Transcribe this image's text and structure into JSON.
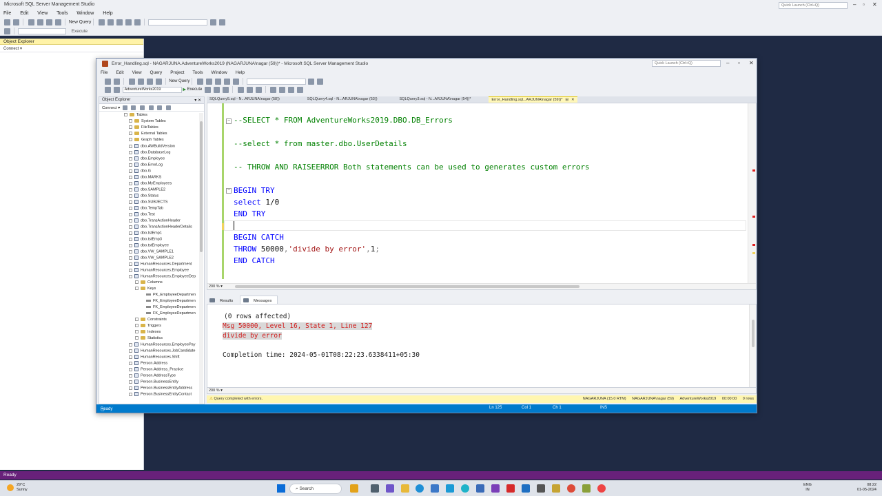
{
  "background_window": {
    "title": "Microsoft SQL Server Management Studio",
    "menu": [
      "File",
      "Edit",
      "View",
      "Tools",
      "Window",
      "Help"
    ],
    "new_query": "New Query",
    "execute": "Execute",
    "quick_launch": "Quick Launch (Ctrl+Q)",
    "object_explorer": "Object Explorer",
    "connect": "Connect",
    "ready": "Ready"
  },
  "main_window": {
    "title": "Error_Handling.sql - NAGARJUNA.AdventureWorks2019 (NAGARJUNA\\nagar (59))* - Microsoft SQL Server Management Studio",
    "quick_launch": "Quick Launch (Ctrl+Q)",
    "menu": [
      "File",
      "Edit",
      "View",
      "Query",
      "Project",
      "Tools",
      "Window",
      "Help"
    ],
    "new_query": "New Query",
    "database": "AdventureWorks2019",
    "execute": "Execute"
  },
  "object_explorer": {
    "title": "Object Explorer",
    "connect": "Connect",
    "nodes": [
      {
        "label": "Tables",
        "indent": 0,
        "icon": "folder",
        "expanded": true
      },
      {
        "label": "System Tables",
        "indent": 1,
        "icon": "folder"
      },
      {
        "label": "FileTables",
        "indent": 1,
        "icon": "folder"
      },
      {
        "label": "External Tables",
        "indent": 1,
        "icon": "folder"
      },
      {
        "label": "Graph Tables",
        "indent": 1,
        "icon": "folder"
      },
      {
        "label": "dbo.AWBuildVersion",
        "indent": 1,
        "icon": "table"
      },
      {
        "label": "dbo.DatabaseLog",
        "indent": 1,
        "icon": "table"
      },
      {
        "label": "dbo.Employee",
        "indent": 1,
        "icon": "table"
      },
      {
        "label": "dbo.ErrorLog",
        "indent": 1,
        "icon": "table"
      },
      {
        "label": "dbo.G",
        "indent": 1,
        "icon": "table"
      },
      {
        "label": "dbo.MARKS",
        "indent": 1,
        "icon": "table"
      },
      {
        "label": "dbo.MyEmployees",
        "indent": 1,
        "icon": "table"
      },
      {
        "label": "dbo.SAMPLE2",
        "indent": 1,
        "icon": "table"
      },
      {
        "label": "dbo.Status",
        "indent": 1,
        "icon": "table"
      },
      {
        "label": "dbo.SUBJECTS",
        "indent": 1,
        "icon": "table"
      },
      {
        "label": "dbo.TempTab",
        "indent": 1,
        "icon": "table"
      },
      {
        "label": "dbo.Test",
        "indent": 1,
        "icon": "table"
      },
      {
        "label": "dbo.TransActionHeader",
        "indent": 1,
        "icon": "table"
      },
      {
        "label": "dbo.TransActionHeaderDetails",
        "indent": 1,
        "icon": "table"
      },
      {
        "label": "dbo.tstEmp1",
        "indent": 1,
        "icon": "table"
      },
      {
        "label": "dbo.tstEmp3",
        "indent": 1,
        "icon": "table"
      },
      {
        "label": "dbo.tstEmployee",
        "indent": 1,
        "icon": "table"
      },
      {
        "label": "dbo.VW_SAMPLE1",
        "indent": 1,
        "icon": "table"
      },
      {
        "label": "dbo.VW_SAMPLE2",
        "indent": 1,
        "icon": "table"
      },
      {
        "label": "HumanResources.Department",
        "indent": 1,
        "icon": "table"
      },
      {
        "label": "HumanResources.Employee",
        "indent": 1,
        "icon": "table"
      },
      {
        "label": "HumanResources.EmployeeDep",
        "indent": 1,
        "icon": "table",
        "expanded": true
      },
      {
        "label": "Columns",
        "indent": 2,
        "icon": "folder"
      },
      {
        "label": "Keys",
        "indent": 2,
        "icon": "folder",
        "expanded": true
      },
      {
        "label": "PK_EmployeeDepartmen",
        "indent": 3,
        "icon": "key"
      },
      {
        "label": "FK_EmployeeDepartmen",
        "indent": 3,
        "icon": "key"
      },
      {
        "label": "FK_EmployeeDepartmen",
        "indent": 3,
        "icon": "key"
      },
      {
        "label": "FK_EmployeeDepartmen",
        "indent": 3,
        "icon": "key"
      },
      {
        "label": "Constraints",
        "indent": 2,
        "icon": "folder"
      },
      {
        "label": "Triggers",
        "indent": 2,
        "icon": "folder"
      },
      {
        "label": "Indexes",
        "indent": 2,
        "icon": "folder"
      },
      {
        "label": "Statistics",
        "indent": 2,
        "icon": "folder"
      },
      {
        "label": "HumanResources.EmployeePay",
        "indent": 1,
        "icon": "table"
      },
      {
        "label": "HumanResources.JobCandidate",
        "indent": 1,
        "icon": "table"
      },
      {
        "label": "HumanResources.Shift",
        "indent": 1,
        "icon": "table"
      },
      {
        "label": "Person.Address",
        "indent": 1,
        "icon": "table"
      },
      {
        "label": "Person.Address_Practice",
        "indent": 1,
        "icon": "table"
      },
      {
        "label": "Person.AddressType",
        "indent": 1,
        "icon": "table"
      },
      {
        "label": "Person.BusinessEntity",
        "indent": 1,
        "icon": "table"
      },
      {
        "label": "Person.BusinessEntityAddress",
        "indent": 1,
        "icon": "table"
      },
      {
        "label": "Person.BusinessEntityContact",
        "indent": 1,
        "icon": "table"
      }
    ]
  },
  "tabs": [
    {
      "label": "SQLQuery5.sql - N...ARJUNA\\nagar (58))",
      "active": false
    },
    {
      "label": "SQLQuery4.sql - N...ARJUNA\\nagar (53))",
      "active": false
    },
    {
      "label": "SQLQuery3.sql - N...ARJUNA\\nagar (54))*",
      "active": false
    },
    {
      "label": "Error_Handling.sql...ARJUNA\\nagar (59))*",
      "active": true
    }
  ],
  "editor": {
    "zoom": "200 %",
    "lines": {
      "l1": "--SELECT * FROM AdventureWorks2019.DBO.DB_Errors",
      "l2": "--select * from master.dbo.UserDetails",
      "l3": "-- THROW AND RAISEERROR Both statements can be used to generates custom errors",
      "kw_begin_try": "BEGIN TRY",
      "kw_select": "select",
      "val_select": "1/0",
      "kw_end_try": "END TRY",
      "kw_begin_catch": "BEGIN CATCH",
      "kw_throw": "THROW",
      "throw_num": "50000",
      "throw_str": "'divide by error'",
      "throw_state": "1",
      "kw_end_catch": "END CATCH"
    }
  },
  "results": {
    "tabs": [
      "Results",
      "Messages"
    ],
    "rows_affected": "(0 rows affected)",
    "error_line1": "Msg 50000, Level 16, State 1, Line 127",
    "error_line2": "divide by error",
    "completion": "Completion time: 2024-05-01T08:22:23.6338411+05:30",
    "zoom": "200 %"
  },
  "query_status": {
    "message": "Query completed with errors.",
    "server": "NAGARJUNA (15.0 RTM)",
    "user": "NAGARJUNA\\nagar (59)",
    "database": "AdventureWorks2019",
    "elapsed": "00:00:00",
    "rows": "0 rows"
  },
  "status_bar": {
    "ready": "Ready",
    "ln": "Ln 125",
    "col": "Col 1",
    "ch": "Ch 1",
    "ins": "INS"
  },
  "taskbar": {
    "temp": "29°C",
    "condition": "Sunny",
    "search": "Search",
    "lang1": "ENG",
    "lang2": "IN",
    "time": "08:22",
    "date": "01-05-2024"
  },
  "colors": {
    "accent": "#007acc",
    "active_tab": "#fff7b8",
    "error_text": "#d11a1a",
    "keyword": "#0000ff",
    "comment": "#008000",
    "string": "#a31515"
  }
}
